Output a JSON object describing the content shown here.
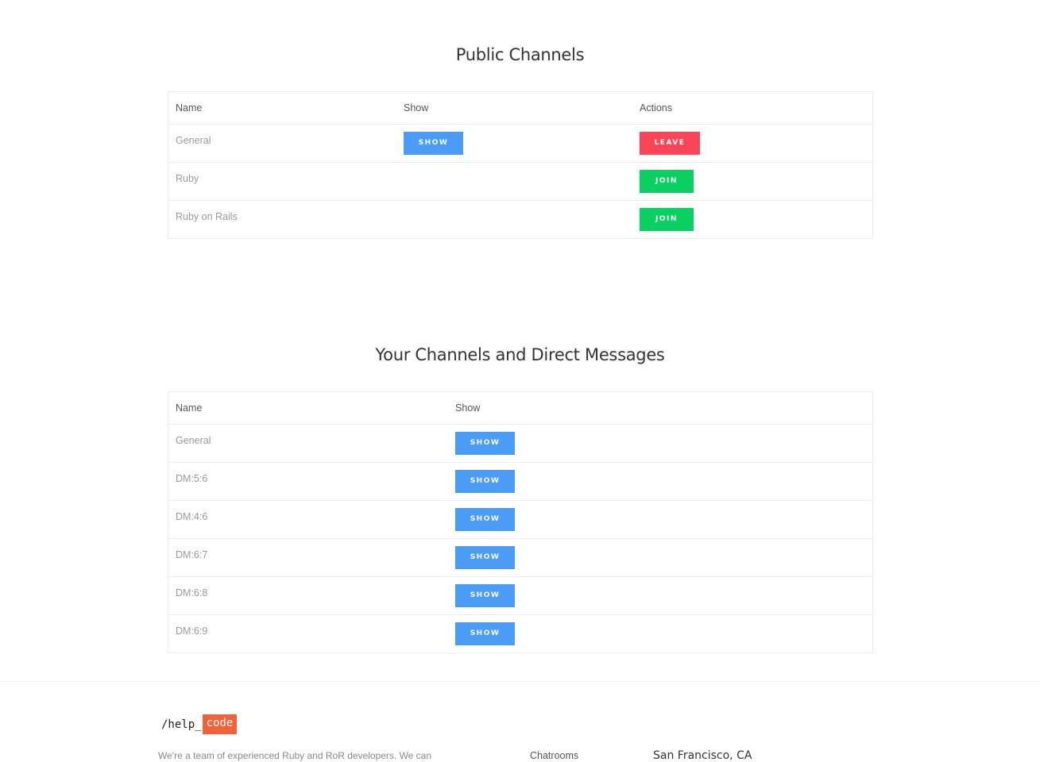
{
  "public_channels": {
    "title": "Public Channels",
    "headers": {
      "name": "Name",
      "show": "Show",
      "actions": "Actions"
    },
    "rows": [
      {
        "name": "General",
        "show_label": "SHOW",
        "action_label": "LEAVE"
      },
      {
        "name": "Ruby",
        "show_label": "",
        "action_label": "JOIN"
      },
      {
        "name": "Ruby on Rails",
        "show_label": "",
        "action_label": "JOIN"
      }
    ]
  },
  "your_channels": {
    "title": "Your Channels and Direct Messages",
    "headers": {
      "name": "Name",
      "show": "Show"
    },
    "rows": [
      {
        "name": "General",
        "show_label": "SHOW"
      },
      {
        "name": "DM:5:6",
        "show_label": "SHOW"
      },
      {
        "name": "DM:4:6",
        "show_label": "SHOW"
      },
      {
        "name": "DM:6:7",
        "show_label": "SHOW"
      },
      {
        "name": "DM:6:8",
        "show_label": "SHOW"
      },
      {
        "name": "DM:6:9",
        "show_label": "SHOW"
      }
    ]
  },
  "footer": {
    "logo_prefix": "/help_",
    "logo_code": "code",
    "blurb": "We're a team of experienced Ruby and RoR developers. We can",
    "link_chatrooms": "Chatrooms",
    "city": "San Francisco, CA"
  },
  "colors": {
    "show_button": "#4a9cf6",
    "leave_button": "#fa4458",
    "join_button": "#0ad062",
    "logo_accent": "#f1623a"
  }
}
